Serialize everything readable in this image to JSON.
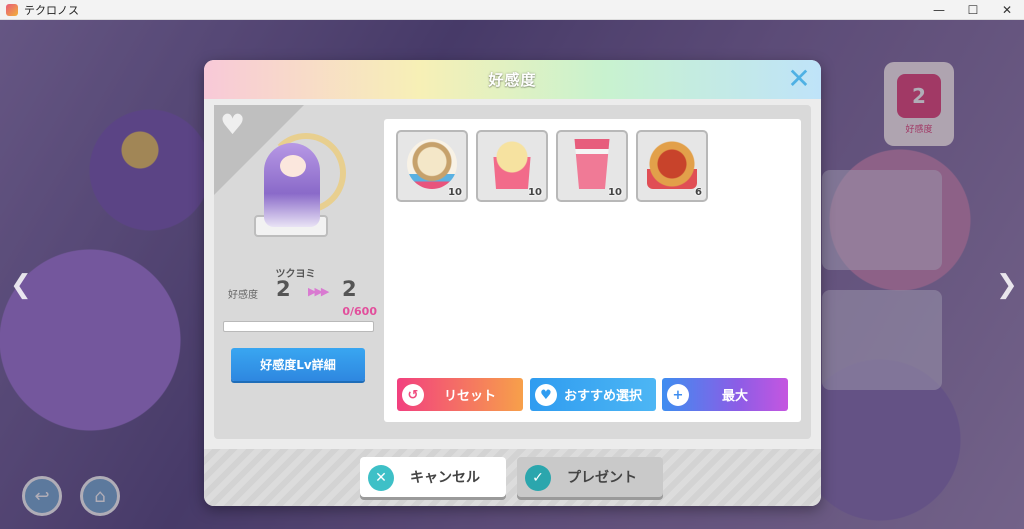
{
  "window": {
    "title": "テクロノス",
    "minimize": "—",
    "maximize": "☐",
    "close": "✕"
  },
  "background": {
    "left_arrow": "❮",
    "right_arrow": "❯",
    "heart_badge_count": "2",
    "heart_badge_label": "好感度"
  },
  "dialog": {
    "title": "好感度",
    "close_glyph": "✕",
    "character": {
      "name": "ツクヨミ",
      "affection_label": "好感度",
      "affection_from": "2",
      "arrows": "▶▶▶",
      "affection_to": "2",
      "exp_text": "0/600",
      "exp_fraction": 0,
      "detail_button": "好感度Lv詳細"
    },
    "items": [
      {
        "name": "cream-bun",
        "count": "10"
      },
      {
        "name": "popcorn",
        "count": "10"
      },
      {
        "name": "drink",
        "count": "10"
      },
      {
        "name": "hotdog",
        "count": "6"
      }
    ],
    "buttons": {
      "reset": "リセット",
      "recommend": "おすすめ選択",
      "max": "最大",
      "cancel": "キャンセル",
      "present": "プレゼント"
    }
  }
}
